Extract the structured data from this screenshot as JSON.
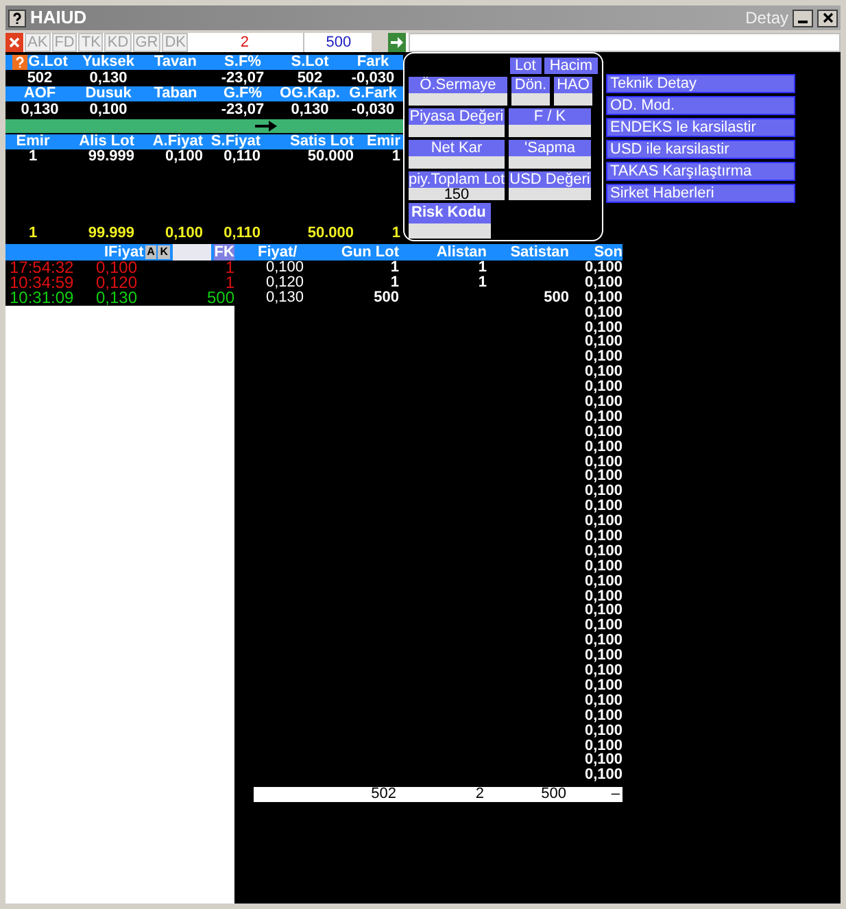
{
  "window": {
    "title": "HAIUD",
    "subtitle": "Detay"
  },
  "toolbar": {
    "tabs": [
      "AK",
      "FD",
      "TK",
      "KD",
      "GR",
      "DK"
    ],
    "count": "2",
    "amount": "500"
  },
  "summary": [
    {
      "cells": [
        {
          "header": "G.Lot",
          "value": "502"
        },
        {
          "header": "Yuksek",
          "value": "0,130"
        },
        {
          "header": "Tavan"
        },
        {
          "header": "S.F%",
          "value": "-23,07"
        },
        {
          "header": "S.Lot",
          "value": "502"
        },
        {
          "header": "Fark",
          "value": "-0,030"
        }
      ]
    },
    {
      "cells": [
        {
          "header": "AOF",
          "value": "0,130"
        },
        {
          "header": "Dusuk",
          "value": "0,100"
        },
        {
          "header": "Taban"
        },
        {
          "header": "G.F%",
          "value": "-23,07"
        },
        {
          "header": "OG.Kap.",
          "value": "0,130"
        },
        {
          "header": "G.Fark",
          "value": "-0,030"
        }
      ]
    }
  ],
  "orders": {
    "columns": [
      "Emir",
      "Alis Lot",
      "A.Fiyat",
      "S.Fiyat",
      "Satis Lot",
      "Emir"
    ],
    "rows": [
      [
        "1",
        "99.999",
        "0,100",
        "0,110",
        "50.000",
        "1"
      ]
    ],
    "total": [
      "1",
      "99.999",
      "0,100",
      "0,110",
      "50.000",
      "1"
    ]
  },
  "info_panel": {
    "unit_buttons": [
      "Lot",
      "Hacim"
    ],
    "rows": [
      [
        {
          "label": "Ö.Sermaye"
        },
        {
          "label": "Dön."
        },
        {
          "label": "HAO"
        }
      ],
      [
        {
          "label": "Piyasa Değeri"
        },
        {
          "label": "F / K"
        }
      ],
      [
        {
          "label": "Net Kar"
        },
        {
          "label": "'Sapma"
        }
      ],
      [
        {
          "label": "piy.Toplam Lot",
          "value": "150"
        },
        {
          "label": "USD Değeri"
        }
      ]
    ],
    "risk_label": "Risk Kodu"
  },
  "menu": [
    "Teknik Detay",
    "OD. Mod.",
    "ENDEKS le karsilastir",
    "USD ile karsilastir",
    "TAKAS Karşılaştırma",
    "Sirket Haberleri"
  ],
  "trades": {
    "header": "IFiyat",
    "buttons": [
      "A",
      "K"
    ],
    "fk": "FK",
    "rows": [
      {
        "time": "17:54:32",
        "price": "0,100",
        "lot": "1",
        "kind": "down"
      },
      {
        "time": "10:34:59",
        "price": "0,120",
        "lot": "1",
        "kind": "down"
      },
      {
        "time": "10:31:09",
        "price": "0,130",
        "lot": "500",
        "kind": "up"
      }
    ]
  },
  "depth": {
    "columns": [
      "Fiyat/",
      "Gun Lot",
      "Alistan",
      "Satistan",
      "Son"
    ],
    "rows": [
      [
        "0,100",
        "1",
        "1",
        "",
        "0,100"
      ],
      [
        "0,120",
        "1",
        "1",
        "",
        "0,100"
      ],
      [
        "0,130",
        "500",
        "",
        "500",
        "0,100"
      ],
      [
        "",
        "",
        "",
        "",
        "0,100"
      ],
      [
        "",
        "",
        "",
        "",
        "0,100"
      ],
      [
        "",
        "",
        "",
        "",
        "0,100"
      ],
      [
        "",
        "",
        "",
        "",
        "0,100"
      ],
      [
        "",
        "",
        "",
        "",
        "0,100"
      ],
      [
        "",
        "",
        "",
        "",
        "0,100"
      ],
      [
        "",
        "",
        "",
        "",
        "0,100"
      ],
      [
        "",
        "",
        "",
        "",
        "0,100"
      ],
      [
        "",
        "",
        "",
        "",
        "0,100"
      ],
      [
        "",
        "",
        "",
        "",
        "0,100"
      ],
      [
        "",
        "",
        "",
        "",
        "0,100"
      ],
      [
        "",
        "",
        "",
        "",
        "0,100"
      ],
      [
        "",
        "",
        "",
        "",
        "0,100"
      ],
      [
        "",
        "",
        "",
        "",
        "0,100"
      ],
      [
        "",
        "",
        "",
        "",
        "0,100"
      ],
      [
        "",
        "",
        "",
        "",
        "0,100"
      ],
      [
        "",
        "",
        "",
        "",
        "0,100"
      ],
      [
        "",
        "",
        "",
        "",
        "0,100"
      ],
      [
        "",
        "",
        "",
        "",
        "0,100"
      ],
      [
        "",
        "",
        "",
        "",
        "0,100"
      ],
      [
        "",
        "",
        "",
        "",
        "0,100"
      ],
      [
        "",
        "",
        "",
        "",
        "0,100"
      ],
      [
        "",
        "",
        "",
        "",
        "0,100"
      ],
      [
        "",
        "",
        "",
        "",
        "0,100"
      ],
      [
        "",
        "",
        "",
        "",
        "0,100"
      ],
      [
        "",
        "",
        "",
        "",
        "0,100"
      ],
      [
        "",
        "",
        "",
        "",
        "0,100"
      ],
      [
        "",
        "",
        "",
        "",
        "0,100"
      ],
      [
        "",
        "",
        "",
        "",
        "0,100"
      ],
      [
        "",
        "",
        "",
        "",
        "0,100"
      ],
      [
        "",
        "",
        "",
        "",
        "0,100"
      ],
      [
        "",
        "",
        "",
        "",
        "0,100"
      ]
    ],
    "totals": {
      "gun_lot": "502",
      "alistan": "2",
      "satistan": "500",
      "son": "–"
    }
  }
}
